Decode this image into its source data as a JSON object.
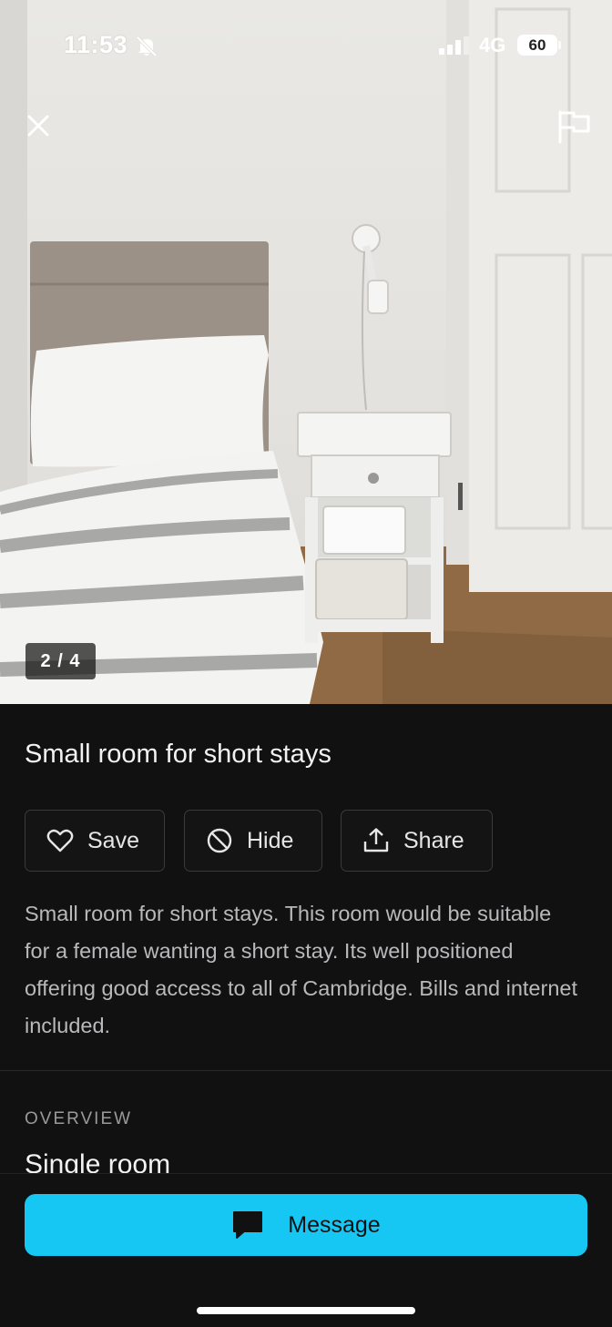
{
  "status_bar": {
    "time": "11:53",
    "network": "4G",
    "battery": "60"
  },
  "gallery": {
    "counter": "2 / 4"
  },
  "listing": {
    "title": "Small room for short stays",
    "description": "Small room for short stays. This room would be suitable for a female wanting a short stay. Its well positioned offering good access to all of Cambridge. Bills and internet included.",
    "overview_label": "OVERVIEW",
    "room_type": "Single room"
  },
  "actions": {
    "save_label": "Save",
    "hide_label": "Hide",
    "share_label": "Share"
  },
  "footer": {
    "message_label": "Message"
  },
  "colors": {
    "accent": "#16c6f3",
    "background": "#111112"
  }
}
